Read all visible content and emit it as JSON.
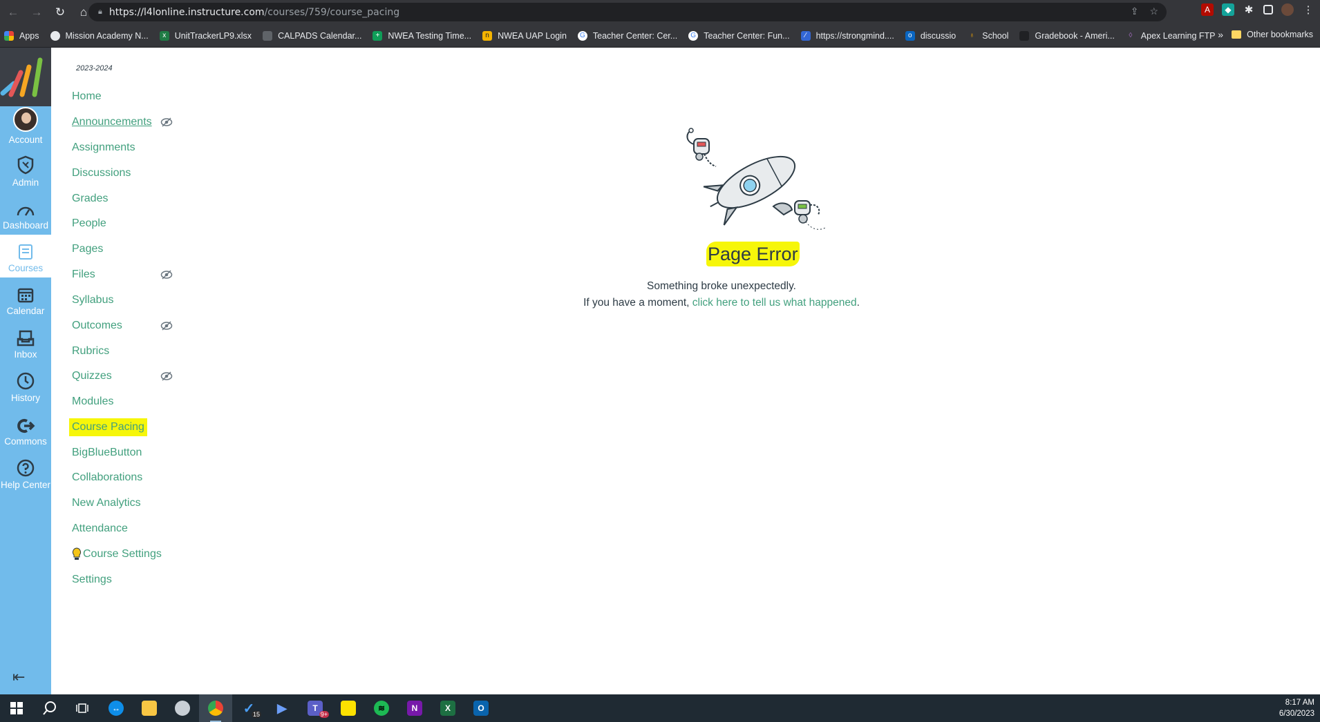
{
  "browser": {
    "url_host": "https://l4lonline.instructure.com",
    "url_path": "/courses/759/course_pacing",
    "bookmarks": [
      {
        "label": "Apps",
        "color": "#e94235"
      },
      {
        "label": "Mission Academy N...",
        "color": "#e8eaed"
      },
      {
        "label": "UnitTrackerLP9.xlsx",
        "color": "#1f7b45"
      },
      {
        "label": "CALPADS Calendar...",
        "color": "#5f6368"
      },
      {
        "label": "NWEA Testing Time...",
        "color": "#0f9d58"
      },
      {
        "label": "NWEA UAP Login",
        "color": "#f4b400"
      },
      {
        "label": "Teacher Center: Cer...",
        "color": "#4285f4"
      },
      {
        "label": "Teacher Center: Fun...",
        "color": "#4285f4"
      },
      {
        "label": "https://strongmind....",
        "color": "#3367d6"
      },
      {
        "label": "discussio",
        "color": "#0a66c2"
      },
      {
        "label": "School",
        "color": "#f9ab00"
      },
      {
        "label": "Gradebook - Ameri...",
        "color": "#202124"
      },
      {
        "label": "Apex Learning FTP",
        "color": "#7cb342"
      }
    ],
    "more_bookmarks": "»",
    "other_bookmarks": "Other bookmarks"
  },
  "global_nav": {
    "items": [
      {
        "label": "Account",
        "icon": "avatar"
      },
      {
        "label": "Admin",
        "icon": "shield-icon"
      },
      {
        "label": "Dashboard",
        "icon": "dashboard-icon"
      },
      {
        "label": "Courses",
        "icon": "courses-icon"
      },
      {
        "label": "Calendar",
        "icon": "calendar-icon"
      },
      {
        "label": "Inbox",
        "icon": "inbox-icon"
      },
      {
        "label": "History",
        "icon": "clock-icon"
      },
      {
        "label": "Commons",
        "icon": "commons-icon"
      },
      {
        "label": "Help Center",
        "icon": "help-icon"
      }
    ],
    "collapse_icon": "⇤"
  },
  "course_nav": {
    "term": "2023-2024",
    "items": [
      {
        "label": "Home"
      },
      {
        "label": "Announcements",
        "hidden_icon": true
      },
      {
        "label": "Assignments"
      },
      {
        "label": "Discussions"
      },
      {
        "label": "Grades"
      },
      {
        "label": "People"
      },
      {
        "label": "Pages"
      },
      {
        "label": "Files",
        "hidden_icon": true
      },
      {
        "label": "Syllabus"
      },
      {
        "label": "Outcomes",
        "hidden_icon": true
      },
      {
        "label": "Rubrics"
      },
      {
        "label": "Quizzes",
        "hidden_icon": true
      },
      {
        "label": "Modules"
      },
      {
        "label": "Course Pacing"
      },
      {
        "label": "BigBlueButton"
      },
      {
        "label": "Collaborations"
      },
      {
        "label": "New Analytics"
      },
      {
        "label": "Attendance"
      },
      {
        "label": "Course Settings",
        "bulb": true
      },
      {
        "label": "Settings"
      }
    ]
  },
  "error": {
    "title": "Page Error",
    "subtitle": "Something broke unexpectedly.",
    "line2_prefix": "If you have a moment, ",
    "link_text": "click here to tell us what happened",
    "line2_suffix": "."
  },
  "taskbar": {
    "time": "8:17 AM",
    "date": "6/30/2023",
    "todo_badge": "15",
    "teams_badge": "9+"
  },
  "colors": {
    "canvas_blue": "#71bbeb",
    "link_green": "#42a07e",
    "highlight": "#f6f60a"
  }
}
